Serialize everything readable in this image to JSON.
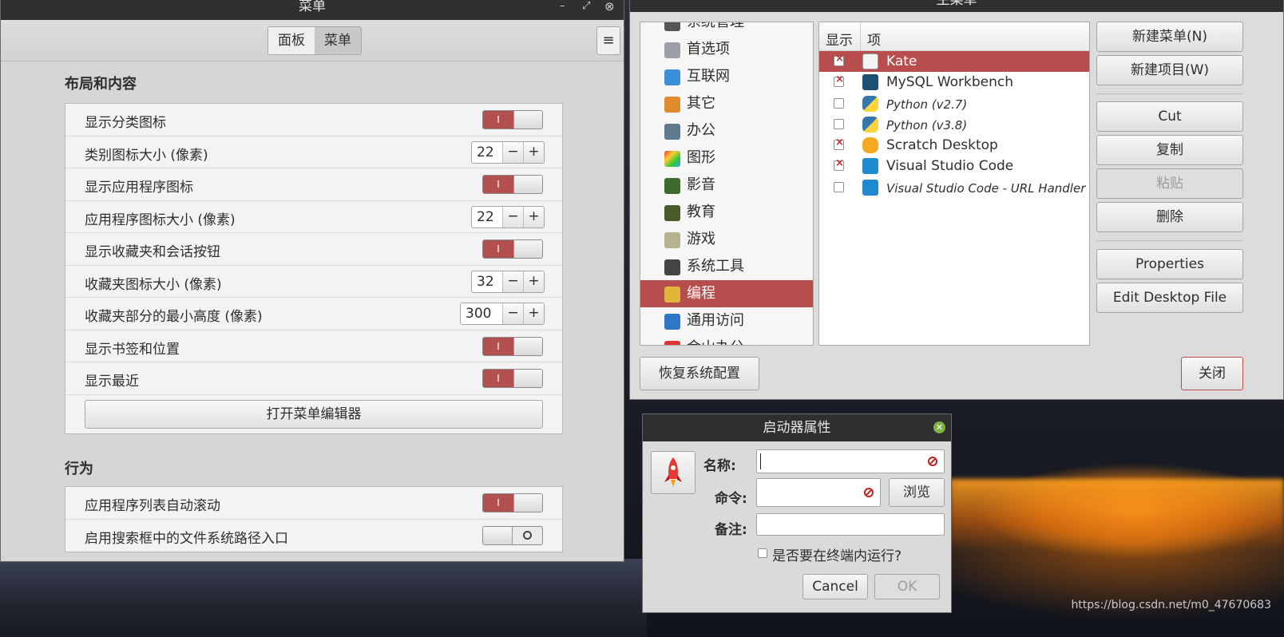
{
  "menu_window": {
    "title": "菜单",
    "tabs": [
      "面板",
      "菜单"
    ],
    "active_tab": "菜单",
    "section_layout": "布局和内容",
    "section_behavior": "行为",
    "rows": [
      {
        "label": "显示分类图标",
        "type": "switch",
        "on": true
      },
      {
        "label": "类别图标大小 (像素)",
        "type": "spin",
        "value": "22"
      },
      {
        "label": "显示应用程序图标",
        "type": "switch",
        "on": true
      },
      {
        "label": "应用程序图标大小 (像素)",
        "type": "spin",
        "value": "22"
      },
      {
        "label": "显示收藏夹和会话按钮",
        "type": "switch",
        "on": true
      },
      {
        "label": "收藏夹图标大小 (像素)",
        "type": "spin",
        "value": "32"
      },
      {
        "label": "收藏夹部分的最小高度 (像素)",
        "type": "spin",
        "value": "300"
      },
      {
        "label": "显示书签和位置",
        "type": "switch",
        "on": true
      },
      {
        "label": "显示最近",
        "type": "switch",
        "on": true
      }
    ],
    "open_editor_button": "打开菜单编辑器",
    "behavior_rows": [
      {
        "label": "应用程序列表自动滚动",
        "on": true
      },
      {
        "label": "启用搜索框中的文件系统路径入口",
        "on": false
      }
    ],
    "switch_on_glyph": "I",
    "spin_minus": "−",
    "spin_plus": "+",
    "menu_glyph": "≡"
  },
  "main_menu_window": {
    "title": "主菜单",
    "categories": [
      {
        "label": "系统管理",
        "icon": "admin-icon"
      },
      {
        "label": "首选项",
        "icon": "preferences-icon"
      },
      {
        "label": "互联网",
        "icon": "internet-icon"
      },
      {
        "label": "其它",
        "icon": "other-icon"
      },
      {
        "label": "办公",
        "icon": "office-icon"
      },
      {
        "label": "图形",
        "icon": "graphics-icon"
      },
      {
        "label": "影音",
        "icon": "multimedia-icon"
      },
      {
        "label": "教育",
        "icon": "education-icon"
      },
      {
        "label": "游戏",
        "icon": "games-icon"
      },
      {
        "label": "系统工具",
        "icon": "system-tools-icon"
      },
      {
        "label": "编程",
        "icon": "programming-icon",
        "selected": true
      },
      {
        "label": "通用访问",
        "icon": "accessibility-icon"
      },
      {
        "label": "金山办公",
        "icon": "wps-icon"
      }
    ],
    "columns": {
      "show": "显示",
      "item": "项"
    },
    "items": [
      {
        "name": "Kate",
        "checked": true,
        "italic": false,
        "selected": true,
        "icon": "kate-icon"
      },
      {
        "name": "MySQL Workbench",
        "checked": true,
        "italic": false,
        "icon": "mysql-icon"
      },
      {
        "name": "Python (v2.7)",
        "checked": false,
        "italic": true,
        "icon": "python-icon"
      },
      {
        "name": "Python (v3.8)",
        "checked": false,
        "italic": true,
        "icon": "python-icon"
      },
      {
        "name": "Scratch Desktop",
        "checked": true,
        "italic": false,
        "icon": "scratch-icon"
      },
      {
        "name": "Visual Studio Code",
        "checked": true,
        "italic": false,
        "icon": "vscode-icon"
      },
      {
        "name": "Visual Studio Code - URL Handler",
        "checked": false,
        "italic": true,
        "icon": "vscode-icon"
      }
    ],
    "buttons": {
      "new_menu": "新建菜单(N)",
      "new_item": "新建项目(W)",
      "cut": "Cut",
      "copy": "复制",
      "paste": "粘贴",
      "delete": "删除",
      "properties": "Properties",
      "edit_desktop": "Edit Desktop File",
      "restore": "恢复系统配置",
      "close": "关闭"
    }
  },
  "launcher_dialog": {
    "title": "启动器属性",
    "name_label": "名称:",
    "command_label": "命令:",
    "comment_label": "备注:",
    "browse": "浏览",
    "terminal_label": "是否要在终端内运行?",
    "cancel": "Cancel",
    "ok": "OK"
  },
  "watermark": "https://blog.csdn.net/m0_47670683",
  "colors": {
    "accent": "#b84d4d",
    "titlebar": "#2f2f2f",
    "window_bg": "#d6d6d6"
  }
}
